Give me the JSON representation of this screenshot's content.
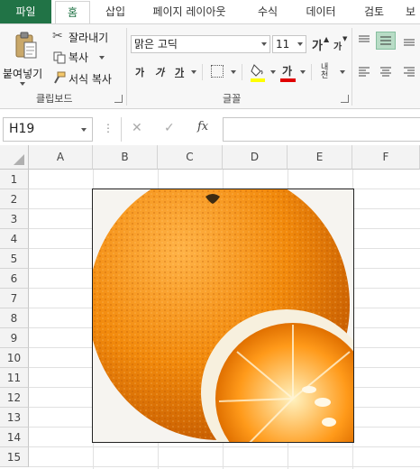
{
  "tabs": [
    "파일",
    "홈",
    "삽입",
    "페이지 레이아웃",
    "수식",
    "데이터",
    "검토",
    "보"
  ],
  "clipboard": {
    "paste_label": "붙여넣기",
    "cut_label": "잘라내기",
    "copy_label": "복사",
    "format_painter_label": "서식 복사",
    "group_label": "클립보드"
  },
  "font": {
    "name": "맑은 고딕",
    "size": "11",
    "grow_label": "가",
    "shrink_label": "가",
    "bold_label": "가",
    "italic_label": "가",
    "underline_label": "가",
    "font_color_label": "가",
    "phonetic_label": "내천",
    "group_label": "글꼴"
  },
  "formula_bar": {
    "name_box": "H19",
    "cancel_glyph": "✕",
    "enter_glyph": "✓",
    "fx_label": "fx",
    "formula": ""
  },
  "sheet": {
    "columns": [
      "A",
      "B",
      "C",
      "D",
      "E",
      "F"
    ],
    "rows": [
      "1",
      "2",
      "3",
      "4",
      "5",
      "6",
      "7",
      "8",
      "9",
      "10",
      "11",
      "12",
      "13",
      "14",
      "15"
    ]
  },
  "picture": {
    "subject": "orange-image"
  },
  "colors": {
    "accent": "#217346",
    "highlight_yellow": "#ffff00",
    "font_red": "#e00000",
    "align_active": "#b8dcc6"
  }
}
